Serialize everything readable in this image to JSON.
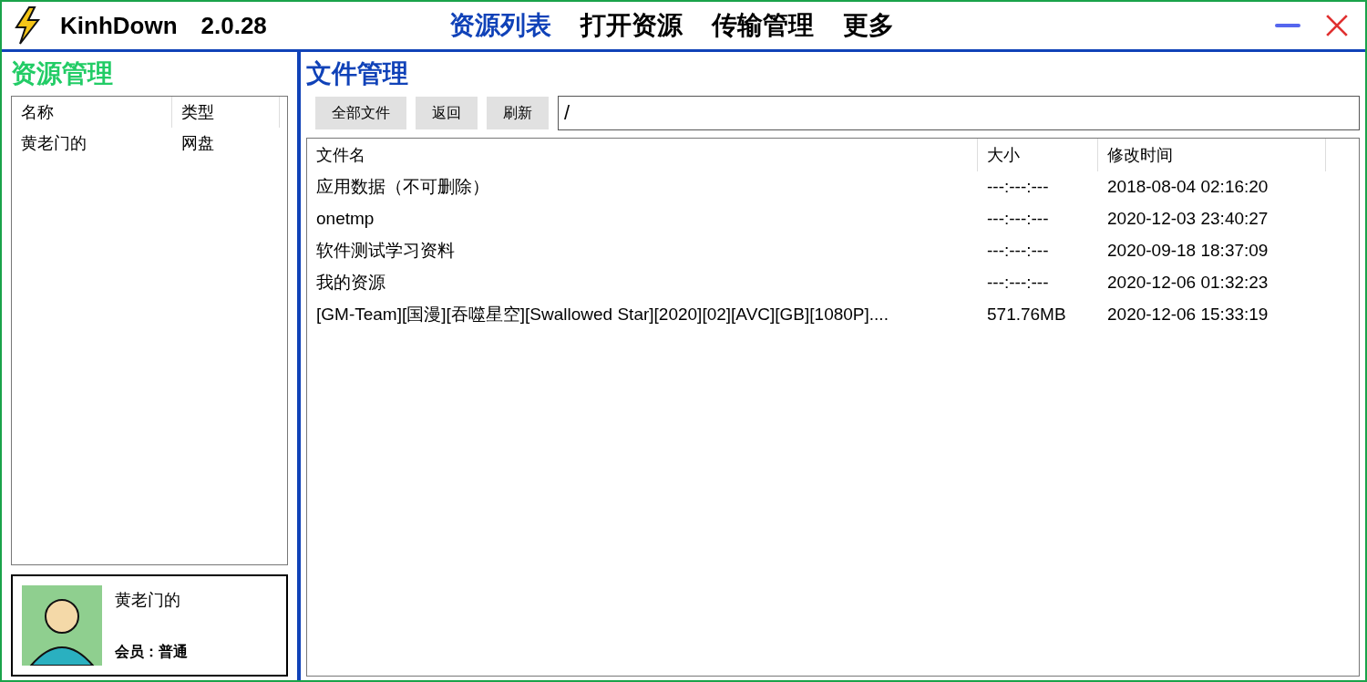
{
  "window": {
    "app_name": "KinhDown",
    "version": "2.0.28"
  },
  "nav": [
    {
      "label": "资源列表",
      "selected": true
    },
    {
      "label": "打开资源",
      "selected": false
    },
    {
      "label": "传输管理",
      "selected": false
    },
    {
      "label": "更多",
      "selected": false
    }
  ],
  "sidebar": {
    "title": "资源管理",
    "columns": [
      "名称",
      "类型"
    ],
    "rows": [
      {
        "name": "黄老门的",
        "type": "网盘",
        "selected": false
      }
    ],
    "user": {
      "name": "黄老门的",
      "membership": "会员：普通"
    }
  },
  "main": {
    "title": "文件管理",
    "buttons": [
      "全部文件",
      "返回",
      "刷新"
    ],
    "path": "/",
    "columns": [
      "文件名",
      "大小",
      "修改时间"
    ],
    "rows": [
      {
        "name": "应用数据（不可删除）",
        "size": "---:---:---",
        "modified": "2018-08-04 02:16:20"
      },
      {
        "name": "onetmp",
        "size": "---:---:---",
        "modified": "2020-12-03 23:40:27"
      },
      {
        "name": "软件测试学习资料",
        "size": "---:---:---",
        "modified": "2020-09-18 18:37:09"
      },
      {
        "name": "我的资源",
        "size": "---:---:---",
        "modified": "2020-12-06 01:32:23"
      },
      {
        "name": "[GM-Team][国漫][吞噬星空][Swallowed Star][2020][02][AVC][GB][1080P]....",
        "size": "571.76MB",
        "modified": "2020-12-06 15:33:19"
      }
    ]
  }
}
